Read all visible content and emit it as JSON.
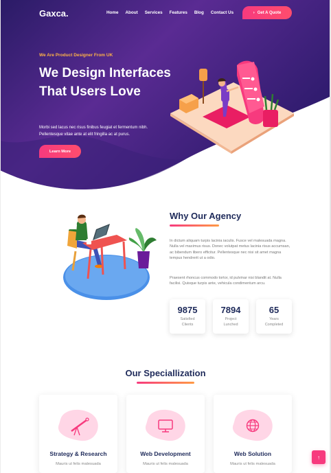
{
  "colors": {
    "brand": "#f73a7e",
    "navy": "#1e2a5a",
    "hero_dark": "#2c1a6b",
    "hero_light": "#6a2fa0",
    "accent_orange": "#ffb347"
  },
  "header": {
    "logo": "Gaxca.",
    "nav": [
      "Home",
      "About",
      "Services",
      "Features",
      "Blog",
      "Contact Us"
    ],
    "cta_icon": "›",
    "cta_label": "Get A Quote"
  },
  "hero": {
    "eyebrow": "We Are Product Designer From UK",
    "headline": "We Design Interfaces That Users Love",
    "text": "Morbi sed lacus nec risus finibus feugiat et fermentum nibh. Pellentesque vitae ante at elit fringilla ac at purus.",
    "button": "Learn More"
  },
  "agency": {
    "title": "Why Our Agency",
    "para1": "In dictum aliquam turpis lacinia iaculis. Fusce vel malesuada magna. Nulla vel maximus risus. Donec volutpat metus lacinia risus accumsan, ac bibendum libero efficitur. Pellentesque nec nisi sit amet magna tempus hendrerit ut a odio.",
    "para2": "Praesent rhoncus commodo tortor, id pulvinar nisi blandit at. Nulla facilisi. Quisque turpis ante, vehicula condimentum arcu.",
    "stats": [
      {
        "value": "9875",
        "label": "Satisfied Clients"
      },
      {
        "value": "7894",
        "label": "Project Lunched"
      },
      {
        "value": "65",
        "label": "Years Completed"
      }
    ]
  },
  "specialization": {
    "title": "Our Speciallization",
    "cards": [
      {
        "icon": "telescope-icon",
        "title": "Strategy & Research",
        "text": "Mauris ut felis malesuada"
      },
      {
        "icon": "monitor-icon",
        "title": "Web Development",
        "text": "Mauris ut felis malesuada"
      },
      {
        "icon": "globe-icon",
        "title": "Web Solution",
        "text": "Mauris ut felis malesuada"
      }
    ]
  },
  "scroll_top_icon": "↑"
}
